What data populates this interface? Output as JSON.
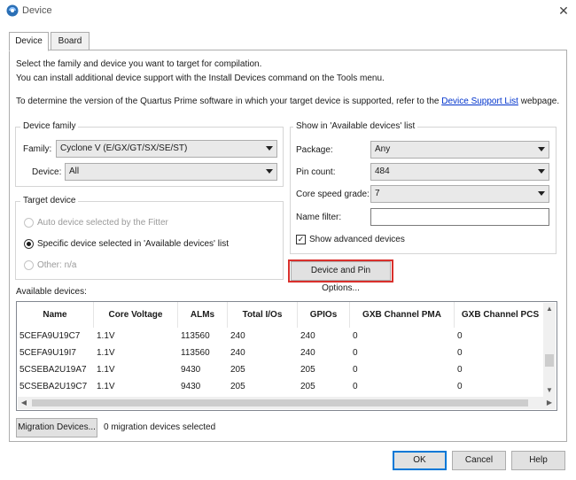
{
  "window": {
    "title": "Device",
    "close_glyph": "✕"
  },
  "tabs": [
    {
      "label": "Device"
    },
    {
      "label": "Board"
    }
  ],
  "intro": {
    "line1": "Select the family and device you want to target for compilation.",
    "line2": "You can install additional device support with the Install Devices command on the Tools menu.",
    "line3_prefix": "To determine the version of the Quartus Prime software in which your target device is supported, refer to the ",
    "line3_link": "Device Support List",
    "line3_suffix": " webpage."
  },
  "device_family": {
    "group_title": "Device family",
    "family_label": "Family:",
    "family_value": "Cyclone V (E/GX/GT/SX/SE/ST)",
    "device_label": "Device:",
    "device_value": "All"
  },
  "target_device": {
    "group_title": "Target device",
    "options": [
      {
        "label": "Auto device selected by the Fitter",
        "selected": false,
        "enabled": false
      },
      {
        "label": "Specific device selected in 'Available devices' list",
        "selected": true,
        "enabled": true
      },
      {
        "label": "Other:  n/a",
        "selected": false,
        "enabled": false
      }
    ]
  },
  "show_list": {
    "group_title": "Show in 'Available devices' list",
    "package_label": "Package:",
    "package_value": "Any",
    "pin_count_label": "Pin count:",
    "pin_count_value": "484",
    "speed_label": "Core speed grade:",
    "speed_value": "7",
    "name_filter_label": "Name filter:",
    "name_filter_value": "",
    "show_advanced_label": "Show advanced devices",
    "show_advanced_checked": true
  },
  "device_pin_button": "Device and Pin Options...",
  "available_devices": {
    "label": "Available devices:",
    "columns": [
      "Name",
      "Core Voltage",
      "ALMs",
      "Total I/Os",
      "GPIOs",
      "GXB Channel PMA",
      "GXB Channel PCS"
    ],
    "rows": [
      [
        "5CEFA9U19C7",
        "1.1V",
        "113560",
        "240",
        "240",
        "0",
        "0"
      ],
      [
        "5CEFA9U19I7",
        "1.1V",
        "113560",
        "240",
        "240",
        "0",
        "0"
      ],
      [
        "5CSEBA2U19A7",
        "1.1V",
        "9430",
        "205",
        "205",
        "0",
        "0"
      ],
      [
        "5CSEBA2U19C7",
        "1.1V",
        "9430",
        "205",
        "205",
        "0",
        "0"
      ]
    ]
  },
  "migration": {
    "button": "Migration Devices...",
    "status": "0 migration devices selected"
  },
  "footer": {
    "ok": "OK",
    "cancel": "Cancel",
    "help": "Help"
  },
  "icons": {
    "app": "quartus-app-icon",
    "close": "close-icon",
    "dropdown": "chevron-down-icon",
    "check": "checkmark-icon"
  },
  "colors": {
    "accent": "#0078d7",
    "highlight_box": "#d9302c",
    "link": "#0033cc"
  }
}
